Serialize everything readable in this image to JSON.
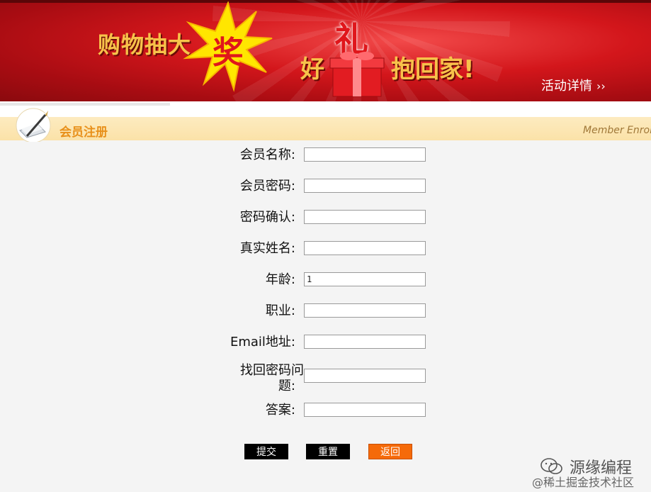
{
  "banner": {
    "slogan_prefix": "购物抽大",
    "slogan_highlight": "奖",
    "good": "好",
    "gift": "礼",
    "home": "抱回家!",
    "detail_link": "活动详情",
    "detail_arrow": "››"
  },
  "section": {
    "title": "会员注册",
    "english": "Member Enrol"
  },
  "form": {
    "fields": [
      {
        "label": "会员名称:",
        "value": ""
      },
      {
        "label": "会员密码:",
        "value": ""
      },
      {
        "label": "密码确认:",
        "value": ""
      },
      {
        "label": "真实姓名:",
        "value": ""
      },
      {
        "label": "年龄:",
        "value": "1"
      },
      {
        "label": "职业:",
        "value": ""
      },
      {
        "label": "Email地址:",
        "value": ""
      },
      {
        "label_line1": "找回密码问",
        "label_line2": "题:",
        "value": ""
      },
      {
        "label": "答案:",
        "value": ""
      }
    ]
  },
  "buttons": {
    "submit": "提交",
    "reset": "重置",
    "back": "返回"
  },
  "watermark": {
    "name": "源缘编程",
    "site": "@稀土掘金技术社区"
  },
  "colors": {
    "banner_red": "#d3161b",
    "slogan_gold": "#f7c24a",
    "section_bg": "#fbe2a8",
    "section_title": "#e8901a",
    "back_button": "#f56a09"
  }
}
